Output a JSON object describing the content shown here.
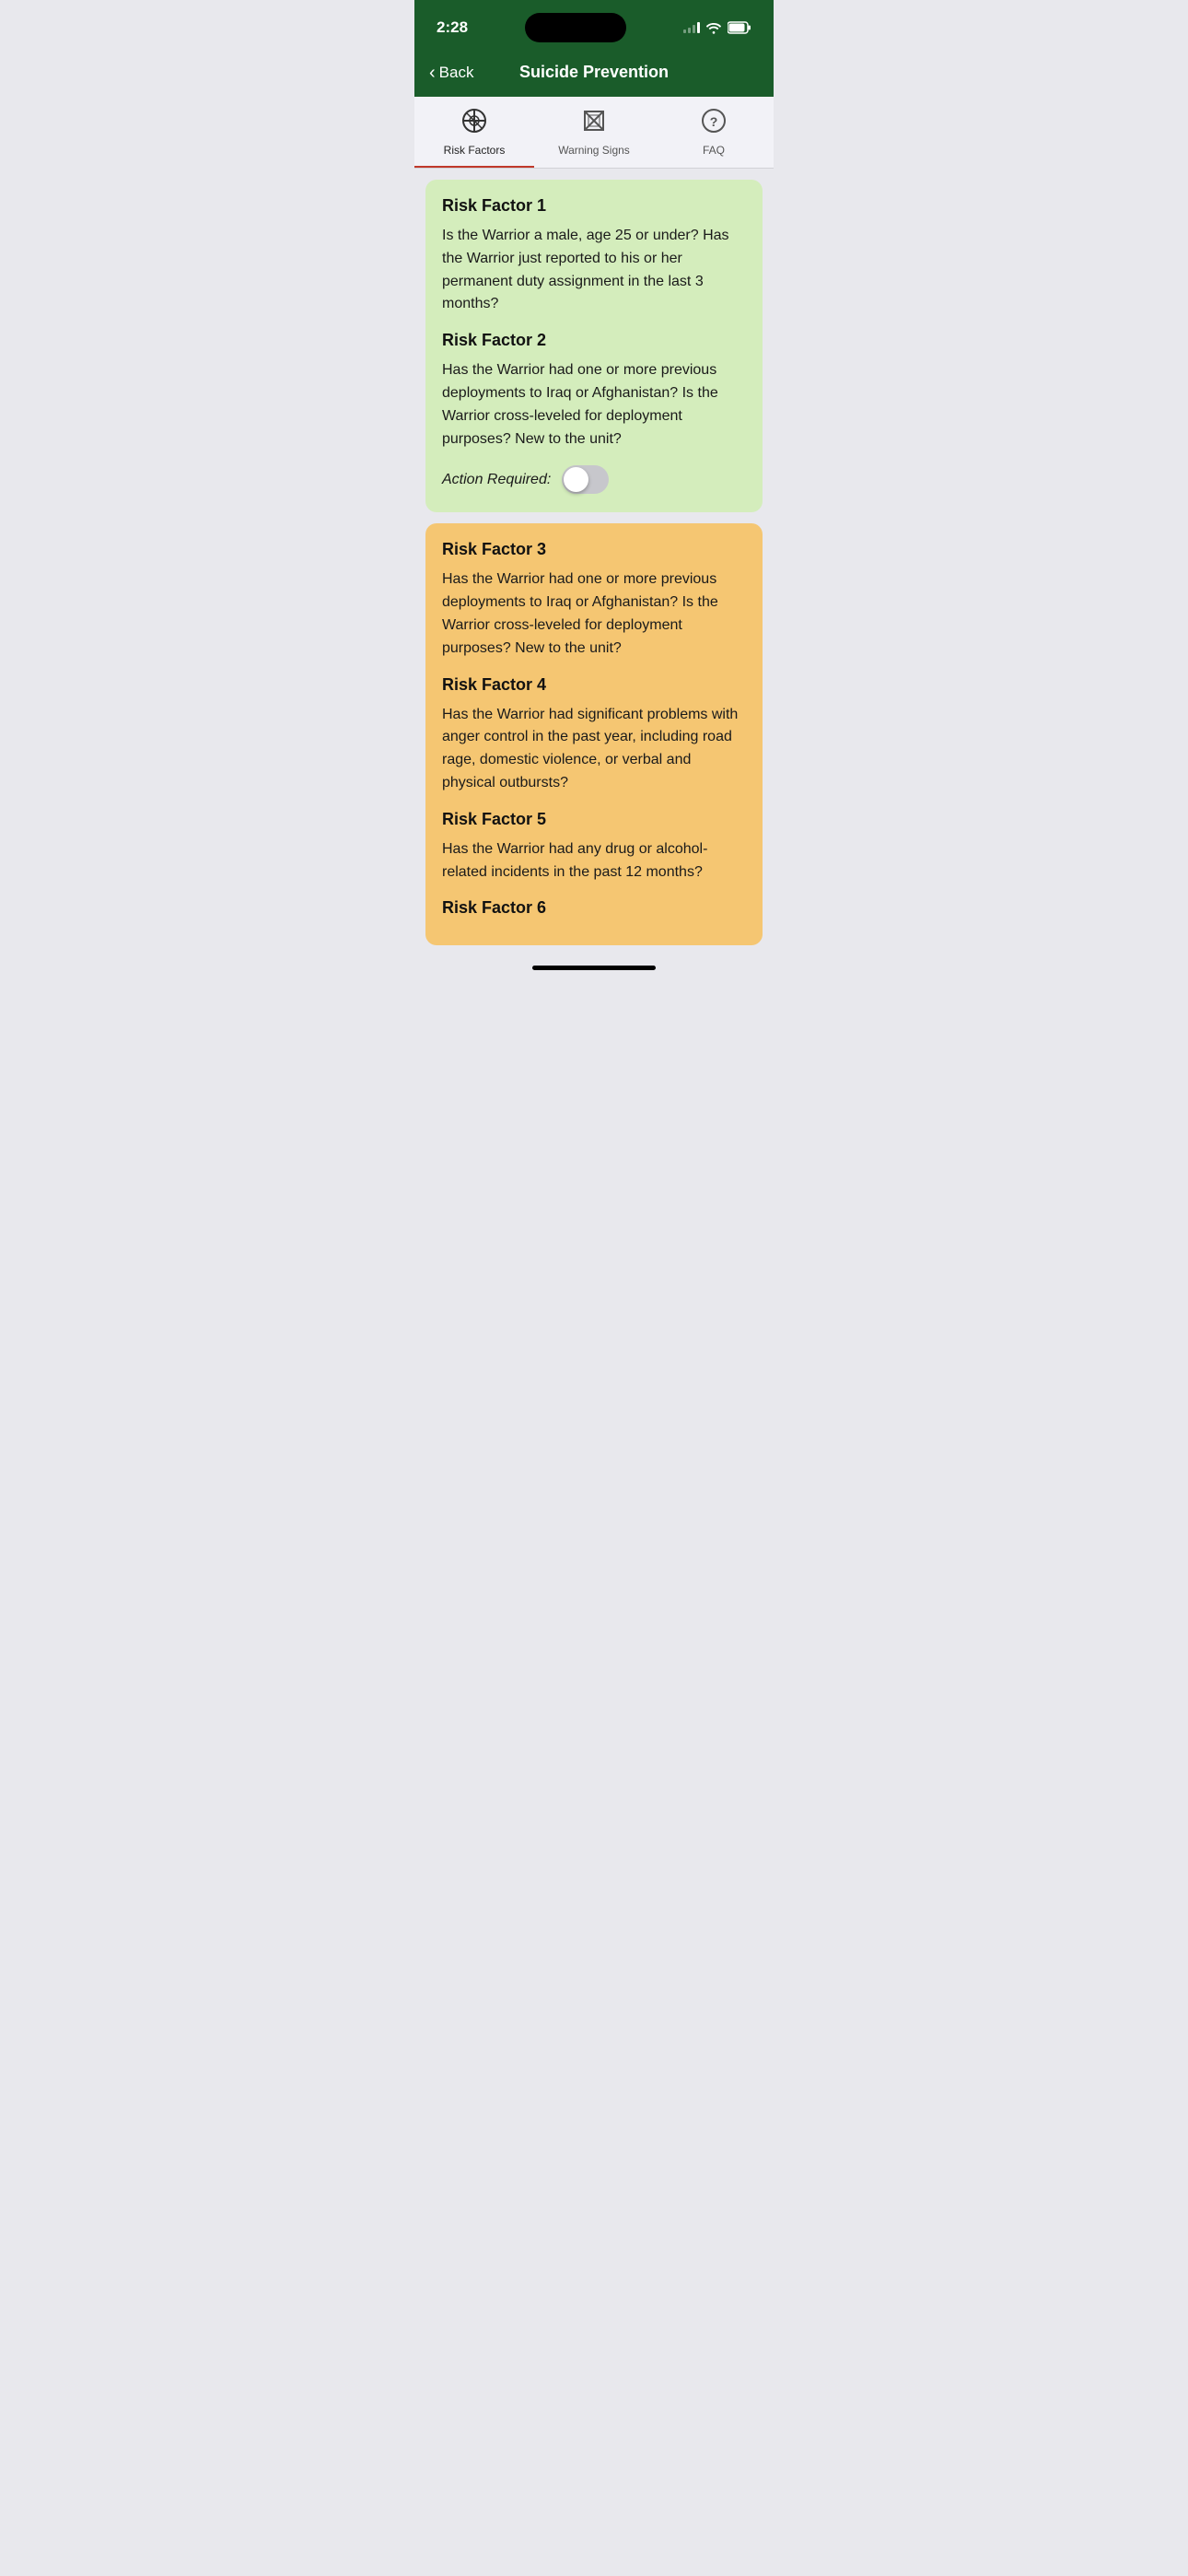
{
  "statusBar": {
    "time": "2:28"
  },
  "navBar": {
    "backLabel": "Back",
    "title": "Suicide Prevention"
  },
  "tabs": [
    {
      "id": "risk-factors",
      "label": "Risk Factors",
      "icon": "⊘",
      "active": true
    },
    {
      "id": "warning-signs",
      "label": "Warning Signs",
      "icon": "⊠",
      "active": false
    },
    {
      "id": "faq",
      "label": "FAQ",
      "icon": "⊙",
      "active": false
    }
  ],
  "greenCard": {
    "factors": [
      {
        "title": "Risk Factor 1",
        "text": "Is the Warrior a male, age 25 or under? Has the Warrior just reported to his or her permanent duty assignment in the last 3 months?"
      },
      {
        "title": "Risk Factor 2",
        "text": "Has the Warrior had one or more previous deployments to Iraq or Afghanistan? Is the Warrior cross-leveled for deployment purposes? New to the unit?"
      }
    ],
    "actionRequired": {
      "label": "Action Required:",
      "toggled": false
    }
  },
  "orangeCard": {
    "factors": [
      {
        "title": "Risk Factor 3",
        "text": "Has the Warrior had one or more previous deployments to Iraq or Afghanistan? Is the Warrior cross-leveled for deployment purposes? New to the unit?"
      },
      {
        "title": "Risk Factor 4",
        "text": "Has the Warrior had significant problems with anger control in the past year, including road rage, domestic violence, or verbal and physical outbursts?"
      },
      {
        "title": "Risk Factor 5",
        "text": "Has the Warrior had any drug or alcohol-related incidents in the past 12 months?"
      },
      {
        "title": "Risk Factor 6",
        "text": ""
      }
    ]
  }
}
